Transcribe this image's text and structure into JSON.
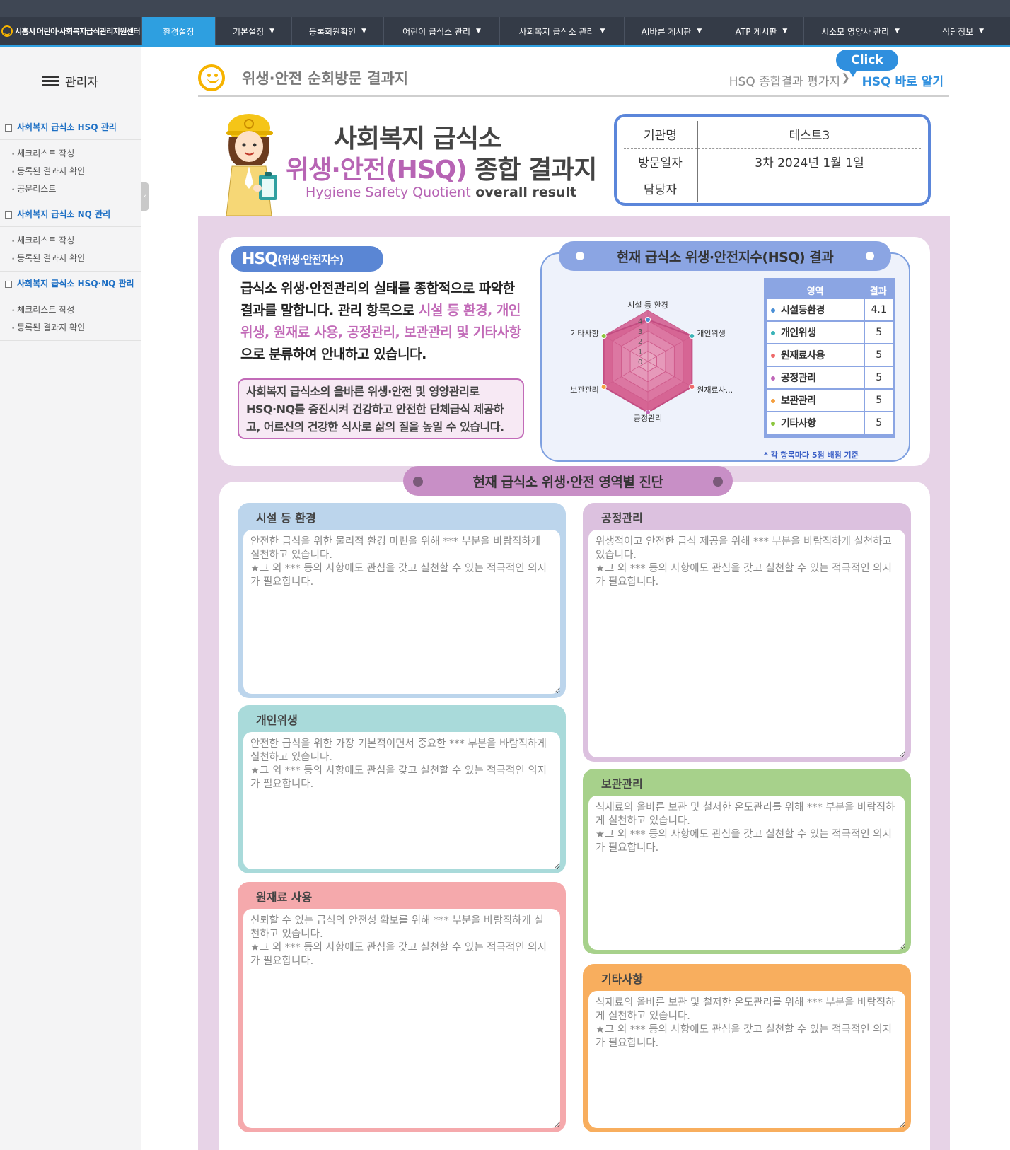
{
  "nav": {
    "logo_text": "시흥시 어린이·사회복지급식관리지원센터",
    "items": [
      "환경설정",
      "기본설정",
      "등록회원확인",
      "어린이 급식소 관리",
      "사회복지 급식소 관리",
      "AI바른 게시판",
      "ATP 게시판",
      "시소모 영양사 관리",
      "식단정보"
    ]
  },
  "sidebar": {
    "title": "관리자",
    "groups": [
      {
        "title": "사회복지 급식소 HSQ 관리",
        "items": [
          "체크리스트 작성",
          "등록된 결과지 확인",
          "공문리스트"
        ]
      },
      {
        "title": "사회복지 급식소 NQ 관리",
        "items": [
          "체크리스트 작성",
          "등록된 결과지 확인"
        ]
      },
      {
        "title": "사회복지 급식소 HSQ·NQ 관리",
        "items": [
          "체크리스트 작성",
          "등록된 결과지 확인"
        ]
      }
    ]
  },
  "page": {
    "title": "위생·안전 순회방문 결과지",
    "crumb": "HSQ 종합결과 평가지",
    "click": "Click",
    "link": "HSQ 바로 알기"
  },
  "hero": {
    "line1": "사회복지 급식소",
    "line2a": "위생·안전(HSQ)",
    "line2b": " 종합 결과지",
    "en1": "Hygiene Safety Quotient",
    "en2": " overall result"
  },
  "info": {
    "rows": [
      {
        "k": "기관명",
        "v": "테스트3"
      },
      {
        "k": "방문일자",
        "v": "3차 2024년 1월 1일"
      },
      {
        "k": "담당자",
        "v": ""
      }
    ]
  },
  "hsq": {
    "pill": "HSQ",
    "pill_small": "(위생·안전지수)",
    "desc_a": "급식소 위생·안전관리의 실태를 종합적으로 파악한 결과를 말합니다. 관리 항목으로 ",
    "desc_b": "시설 등 환경, 개인위생, 원재료 사용, 공정관리, 보관관리 및 기타사항",
    "desc_c": "으로 분류하여 안내하고 있습니다.",
    "note": "사회복지 급식소의 올바른 위생·안전 및 영양관리로 HSQ·NQ를 증진시켜 건강하고 안전한 단체급식 제공하고, 어르신의 건강한 식사로 삶의 질을 높일 수 있습니다."
  },
  "result": {
    "title": "현재 급식소 위생·안전지수(HSQ) 결과",
    "col_area": "영역",
    "col_result": "결과",
    "rows": [
      {
        "name": "시설등환경",
        "value": "4.1",
        "color": "#4a8fd6"
      },
      {
        "name": "개인위생",
        "value": "5",
        "color": "#3bb3b8"
      },
      {
        "name": "원재료사용",
        "value": "5",
        "color": "#ee6a6a"
      },
      {
        "name": "공정관리",
        "value": "5",
        "color": "#c066b8"
      },
      {
        "name": "보관관리",
        "value": "5",
        "color": "#f4a040"
      },
      {
        "name": "기타사항",
        "value": "5",
        "color": "#8cc63f"
      }
    ],
    "note": "* 각 항목마다 5점 배점 기준"
  },
  "chart_data": {
    "type": "radar",
    "categories": [
      "시설 등 환경",
      "개인위생",
      "원재료사...",
      "공정관리",
      "보관관리",
      "기타사항"
    ],
    "values": [
      4.1,
      5,
      5,
      5,
      5,
      5
    ],
    "ticks": [
      "0",
      "1",
      "2",
      "3",
      "4"
    ],
    "range": [
      0,
      5
    ]
  },
  "diag": {
    "title": "현재 급식소 위생·안전 영역별 진단",
    "sections": [
      {
        "label": "시설 등 환경",
        "text": "안전한 급식을 위한 물리적 환경 마련을 위해 *** 부분을 바람직하게 실천하고 있습니다.\n★그 외 *** 등의 사항에도 관심을 갖고 실천할 수 있는 적극적인 의지가 필요합니다."
      },
      {
        "label": "개인위생",
        "text": "안전한 급식을 위한 가장 기본적이면서 중요한 *** 부분을 바람직하게 실천하고 있습니다.\n★그 외 *** 등의 사항에도 관심을 갖고 실천할 수 있는 적극적인 의지가 필요합니다."
      },
      {
        "label": "원재료 사용",
        "text": "신뢰할 수 있는 급식의 안전성 확보를 위해 *** 부분을 바람직하게 실천하고 있습니다.\n★그 외 *** 등의 사항에도 관심을 갖고 실천할 수 있는 적극적인 의지가 필요합니다."
      },
      {
        "label": "공정관리",
        "text": "위생적이고 안전한 급식 제공을 위해 *** 부분을 바람직하게 실천하고 있습니다.\n★그 외 *** 등의 사항에도 관심을 갖고 실천할 수 있는 적극적인 의지가 필요합니다."
      },
      {
        "label": "보관관리",
        "text": "식재료의 올바른 보관 및 철저한 온도관리를 위해 *** 부분을 바람직하게 실천하고 있습니다.\n★그 외 *** 등의 사항에도 관심을 갖고 실천할 수 있는 적극적인 의지가 필요합니다."
      },
      {
        "label": "기타사항",
        "text": "식재료의 올바른 보관 및 철저한 온도관리를 위해 *** 부분을 바람직하게 실천하고 있습니다.\n★그 외 *** 등의 사항에도 관심을 갖고 실천할 수 있는 적극적인 의지가 필요합니다."
      }
    ]
  },
  "colors": {
    "nav_active": "#2e9fe0",
    "sec_env": "#bcd5ec",
    "sec_personal": "#a9dada",
    "sec_raw": "#f5a9ac",
    "sec_process": "#dcc1df",
    "sec_storage": "#a7d18b",
    "sec_etc": "#f8ae5e"
  }
}
